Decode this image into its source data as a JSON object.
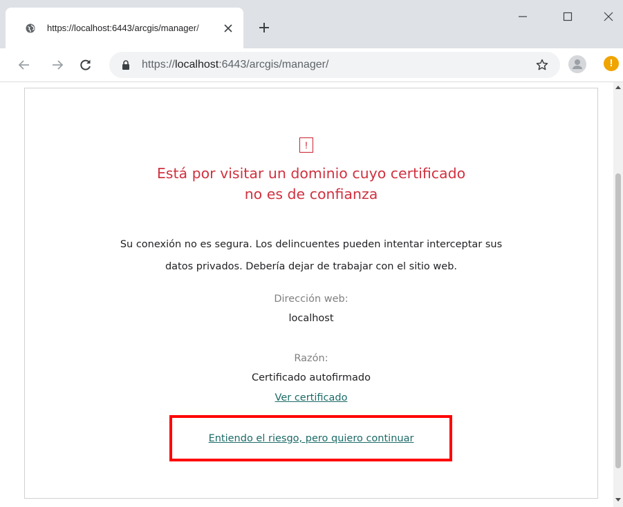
{
  "browser": {
    "tab_title": "https://localhost:6443/arcgis/manager/",
    "url_prefix": "https://",
    "url_host": "localhost",
    "url_rest": ":6443/arcgis/manager/",
    "icons": {
      "favicon": "globe-icon",
      "tab_close": "close-icon",
      "new_tab": "plus-icon",
      "minimize": "minimize-icon",
      "maximize": "maximize-icon",
      "window_close": "close-icon",
      "back": "arrow-left-icon",
      "forward": "arrow-right-icon",
      "reload": "reload-icon",
      "lock": "lock-icon",
      "bookmark": "star-icon",
      "profile": "avatar-icon",
      "alert": "exclamation-icon"
    },
    "alert_glyph": "!"
  },
  "page": {
    "warning_glyph": "!",
    "heading_line1": "Está por visitar un dominio cuyo certificado",
    "heading_line2": "no es de confianza",
    "description_line1": "Su conexión no es segura. Los delincuentes pueden intentar interceptar sus",
    "description_line2": "datos privados. Debería dejar de trabajar con el sitio web.",
    "address_label": "Dirección web:",
    "address_value": "localhost",
    "reason_label": "Razón:",
    "reason_value": "Certificado autofirmado",
    "view_certificate_link": "Ver certificado",
    "continue_link": "Entiendo el riesgo, pero quiero continuar"
  },
  "colors": {
    "heading": "#d0313f",
    "link": "#1b6a66",
    "highlight_border": "#ff0000"
  }
}
